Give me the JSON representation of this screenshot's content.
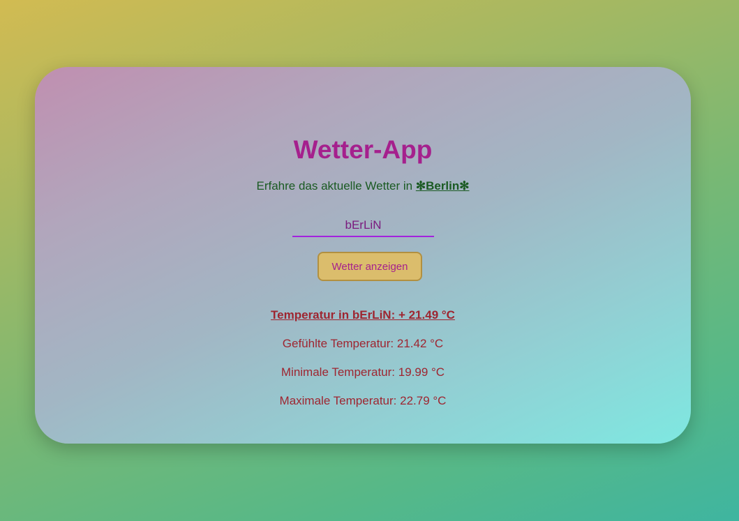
{
  "app": {
    "title": "Wetter-App",
    "subtitle_prefix": "Erfahre das aktuelle Wetter in ",
    "subtitle_city": "✻Berlin✻"
  },
  "search": {
    "value": "bErLiN",
    "button_label": "Wetter anzeigen"
  },
  "results": {
    "temperature": "Temperatur in bErLiN: + 21.49 °C",
    "feels_like": "Gefühlte Temperatur: 21.42 °C",
    "min_temp": "Minimale Temperatur: 19.99 °C",
    "max_temp": "Maximale Temperatur: 22.79 °C"
  },
  "colors": {
    "title": "#a5208d",
    "subtitle": "#1a5a22",
    "input_underline": "#a322dd",
    "button_bg": "#dbbd6c",
    "button_border": "#b29040",
    "results": "#9e2530"
  }
}
